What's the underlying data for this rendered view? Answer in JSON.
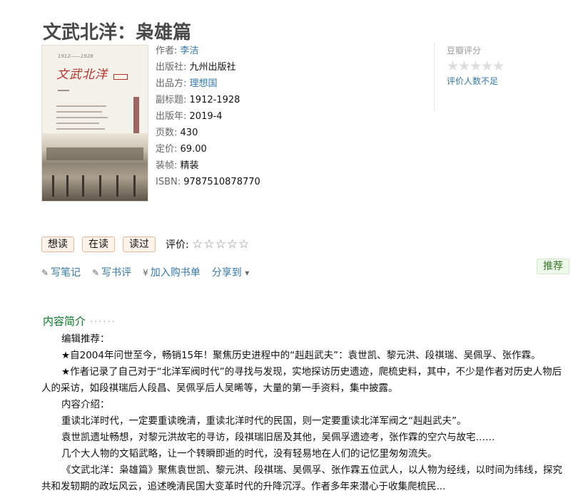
{
  "book": {
    "title": "文武北洋：枭雄篇",
    "cover": {
      "year_text": "1912——1928",
      "title_text": "文武北洋"
    }
  },
  "info": {
    "author_label": "作者:",
    "author": "李洁",
    "publisher_label": "出版社:",
    "publisher": "九州出版社",
    "producer_label": "出品方:",
    "producer": "理想国",
    "subtitle_label": "副标题:",
    "subtitle": "1912-1928",
    "pubyear_label": "出版年:",
    "pubyear": "2019-4",
    "pages_label": "页数:",
    "pages": "430",
    "price_label": "定价:",
    "price": "69.00",
    "binding_label": "装帧:",
    "binding": "精装",
    "isbn_label": "ISBN:",
    "isbn": "9787510878770"
  },
  "rating": {
    "label": "豆瓣评分",
    "stars": "★★★★★",
    "note": "评价人数不足"
  },
  "actions": {
    "want": "想读",
    "reading": "在读",
    "read": "读过",
    "my_rating_label": "评价:",
    "my_rating_stars": "☆☆☆☆☆"
  },
  "links": {
    "note_icon": "✎",
    "note": "写笔记",
    "review_icon": "✎",
    "review": "写书评",
    "cart_icon": "¥",
    "cart": "加入购书单",
    "share": "分享到",
    "share_arrow": "▾"
  },
  "recommend": "推荐",
  "intro": {
    "heading": "内容简介",
    "dots": "······",
    "paragraphs": [
      "编辑推荐：",
      "★自2004年问世至今，畅销15年！聚焦历史进程中的“赳赳武夫”：袁世凯、黎元洪、段祺瑞、吴佩孚、张作霖。",
      "★作者记录了自己对于“北洋军阀时代”的寻找与发现，实地探访历史遗迹，爬梳史料，其中，不少是作者对历史人物后人的采访，如段祺瑞后人段昌、吴佩孚后人吴晞等，大量的第一手资料，集中披露。",
      "内容介绍：",
      "重读北洋时代，一定要重读晚清，重读北洋时代的民国，则一定要重读北洋军阀之“赳赳武夫”。",
      "袁世凯遗址畅想，对黎元洪故宅的寻访，段祺瑞旧居及其他，吴佩孚遗迹考，张作霖的空穴与故宅……",
      "几个大人物的文韬武略，让一个转瞬即逝的时代，没有轻易地在人们的记忆里匆匆流失。",
      "《文武北洋：枭雄篇》聚焦袁世凯、黎元洪、段祺瑞、吴佩孚、张作霖五位武人，以人物为经线，以时间为纬线，探究共和发轫期的政坛风云，追述晚清民国大变革时代的升降沉浮。作者多年来潜心于收集爬梳民..."
    ]
  }
}
